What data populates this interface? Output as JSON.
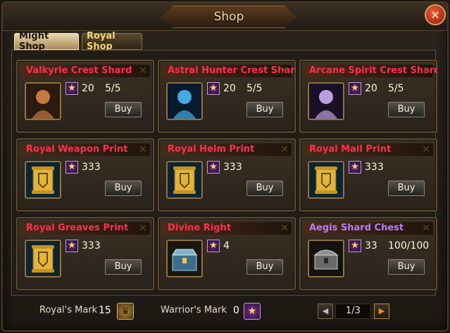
{
  "title": "Shop",
  "close_icon": "close-icon",
  "tabs": [
    {
      "label": "Might Shop",
      "active": true
    },
    {
      "label": "Royal Shop",
      "active": false
    }
  ],
  "items": [
    {
      "name": "Valkyrie Crest Shard",
      "price": "20",
      "stock": "5/5",
      "buy": "Buy",
      "color": "red",
      "icon": "valkyrie-portrait-icon"
    },
    {
      "name": "Astral Hunter Crest Shard",
      "price": "20",
      "stock": "5/5",
      "buy": "Buy",
      "color": "red",
      "icon": "astral-hunter-portrait-icon"
    },
    {
      "name": "Arcane Spirit Crest Shard",
      "price": "20",
      "stock": "5/5",
      "buy": "Buy",
      "color": "red",
      "icon": "arcane-spirit-portrait-icon"
    },
    {
      "name": "Royal Weapon Print",
      "price": "333",
      "stock": "",
      "buy": "Buy",
      "color": "red",
      "icon": "weapon-print-scroll-icon"
    },
    {
      "name": "Royal Helm Print",
      "price": "333",
      "stock": "",
      "buy": "Buy",
      "color": "red",
      "icon": "helm-print-scroll-icon"
    },
    {
      "name": "Royal Mail Print",
      "price": "333",
      "stock": "",
      "buy": "Buy",
      "color": "red",
      "icon": "mail-print-scroll-icon"
    },
    {
      "name": "Royal Greaves Print",
      "price": "333",
      "stock": "",
      "buy": "Buy",
      "color": "red",
      "icon": "greaves-print-scroll-icon"
    },
    {
      "name": "Divine Right",
      "price": "4",
      "stock": "",
      "buy": "Buy",
      "color": "red",
      "icon": "divine-right-chest-icon"
    },
    {
      "name": "Aegis Shard Chest",
      "price": "33",
      "stock": "100/100",
      "buy": "Buy",
      "color": "purple",
      "icon": "aegis-chest-icon"
    }
  ],
  "footer": {
    "royal_mark_label": "Royal's Mark",
    "royal_mark_value": "15",
    "warrior_mark_label": "Warrior's Mark",
    "warrior_mark_value": "0",
    "page": "1/3"
  },
  "colors": {
    "item_name_red": "#ff2f52",
    "item_name_purple": "#b97cff",
    "tab_active_bg": "#e9d7ad",
    "tab_inactive_text": "#f1d57a",
    "pager_next_arrow": "#ff8a1a"
  }
}
